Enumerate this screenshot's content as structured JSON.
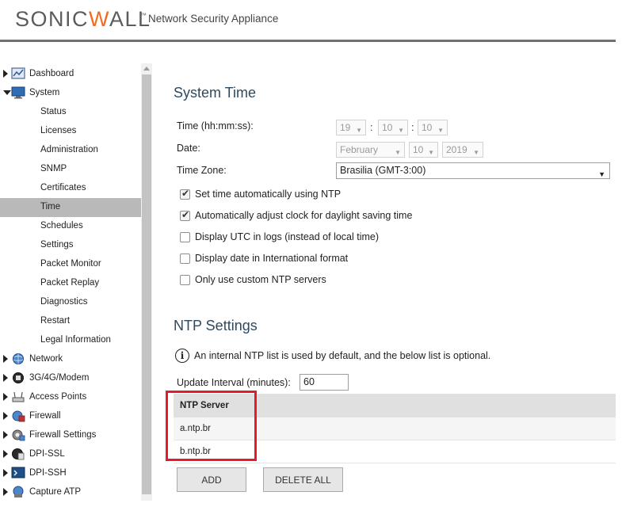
{
  "header": {
    "logo_text": "SONICWALL",
    "logo_tm": "™",
    "app_title": "Network Security Appliance"
  },
  "sidebar": {
    "items": [
      {
        "label": "Dashboard",
        "icon": "dashboard-icon",
        "expanded": false
      },
      {
        "label": "System",
        "icon": "monitor-icon",
        "expanded": true
      },
      {
        "label": "Network",
        "icon": "globe-icon",
        "expanded": false
      },
      {
        "label": "3G/4G/Modem",
        "icon": "modem-icon",
        "expanded": false
      },
      {
        "label": "Access Points",
        "icon": "access-point-icon",
        "expanded": false
      },
      {
        "label": "Firewall",
        "icon": "firewall-icon",
        "expanded": false
      },
      {
        "label": "Firewall Settings",
        "icon": "firewall-settings-icon",
        "expanded": false
      },
      {
        "label": "DPI-SSL",
        "icon": "dpi-ssl-icon",
        "expanded": false
      },
      {
        "label": "DPI-SSH",
        "icon": "dpi-ssh-icon",
        "expanded": false
      },
      {
        "label": "Capture ATP",
        "icon": "capture-atp-icon",
        "expanded": false
      }
    ],
    "system_subitems": [
      "Status",
      "Licenses",
      "Administration",
      "SNMP",
      "Certificates",
      "Time",
      "Schedules",
      "Settings",
      "Packet Monitor",
      "Packet Replay",
      "Diagnostics",
      "Restart",
      "Legal Information"
    ],
    "active_subitem": "Time"
  },
  "system_time": {
    "title": "System Time",
    "time_label": "Time (hh:mm:ss):",
    "hour": "19",
    "minute": "10",
    "second": "10",
    "colon": ":",
    "date_label": "Date:",
    "month": "February",
    "day": "10",
    "year": "2019",
    "timezone_label": "Time Zone:",
    "timezone": "Brasilia (GMT-3:00)",
    "checkboxes": [
      {
        "label": "Set time automatically using NTP",
        "checked": true
      },
      {
        "label": "Automatically adjust clock for daylight saving time",
        "checked": true
      },
      {
        "label": "Display UTC in logs (instead of local time)",
        "checked": false
      },
      {
        "label": "Display date in International format",
        "checked": false
      },
      {
        "label": "Only use custom NTP servers",
        "checked": false
      }
    ]
  },
  "ntp_settings": {
    "title": "NTP Settings",
    "info_text": "An internal NTP list is used by default, and the below list is optional.",
    "interval_label": "Update Interval (minutes):",
    "interval_value": "60",
    "table_header": "NTP Server",
    "servers": [
      "a.ntp.br",
      "b.ntp.br"
    ],
    "add_label": "ADD",
    "delete_all_label": "DELETE ALL"
  },
  "colors": {
    "title_color": "#2d4a61",
    "highlight": "#e21c2c",
    "logo_accent": "#f26b21"
  }
}
